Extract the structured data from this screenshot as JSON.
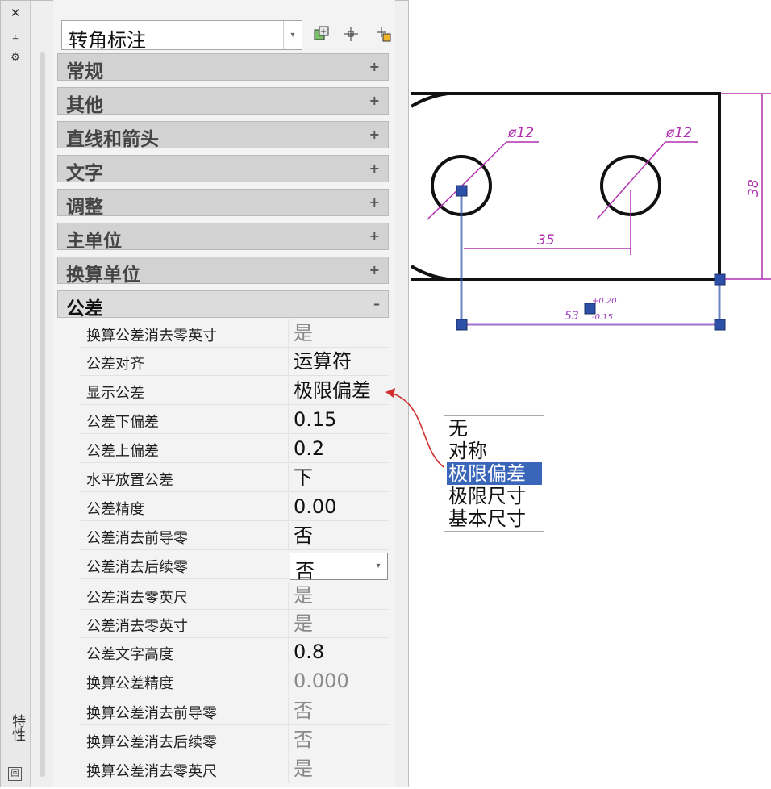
{
  "palette": {
    "title_vertical": "特性",
    "close_icon_glyph": "✕",
    "pin_icon_glyph": "⫠",
    "settings_icon_glyph": "⚙",
    "bottom_icon_glyph": "回",
    "selector": {
      "value": "转角标注"
    },
    "categories": [
      {
        "label": "常规",
        "sign": "+"
      },
      {
        "label": "其他",
        "sign": "+"
      },
      {
        "label": "直线和箭头",
        "sign": "+"
      },
      {
        "label": "文字",
        "sign": "+"
      },
      {
        "label": "调整",
        "sign": "+"
      },
      {
        "label": "主单位",
        "sign": "+"
      },
      {
        "label": "换算单位",
        "sign": "+"
      },
      {
        "label": "公差",
        "sign": "–"
      }
    ],
    "properties": [
      {
        "name": "换算公差消去零英寸",
        "value": "是"
      },
      {
        "name": "公差对齐",
        "value": "运算符"
      },
      {
        "name": "显示公差",
        "value": "极限偏差"
      },
      {
        "name": "公差下偏差",
        "value": "0.15"
      },
      {
        "name": "公差上偏差",
        "value": "0.2"
      },
      {
        "name": "水平放置公差",
        "value": "下"
      },
      {
        "name": "公差精度",
        "value": "0.00"
      },
      {
        "name": "公差消去前导零",
        "value": "否"
      },
      {
        "name": "公差消去后续零",
        "value": "否"
      },
      {
        "name": "公差消去零英尺",
        "value": "是"
      },
      {
        "name": "公差消去零英寸",
        "value": "是"
      },
      {
        "name": "公差文字高度",
        "value": "0.8"
      },
      {
        "name": "换算公差精度",
        "value": "0.000"
      },
      {
        "name": "换算公差消去前导零",
        "value": "否"
      },
      {
        "name": "换算公差消去后续零",
        "value": "否"
      },
      {
        "name": "换算公差消去零英尺",
        "value": "是"
      }
    ]
  },
  "dropdown": {
    "options": [
      "无",
      "对称",
      "极限偏差",
      "极限尺寸",
      "基本尺寸"
    ],
    "selected": "极限偏差"
  },
  "drawing": {
    "dim_dia_left": "ø12",
    "dim_dia_right": "ø12",
    "dim_horizontal": "35",
    "dim_vertical": "38",
    "dim_selected": "53",
    "tol_upper": "+0.20",
    "tol_lower": "-0.15"
  },
  "colors": {
    "dimension": "#b030b0",
    "selection": "#2f53a8",
    "grip": "#2c4fa8",
    "callout_arrow": "#d03030",
    "highlight": "#3966b9"
  }
}
